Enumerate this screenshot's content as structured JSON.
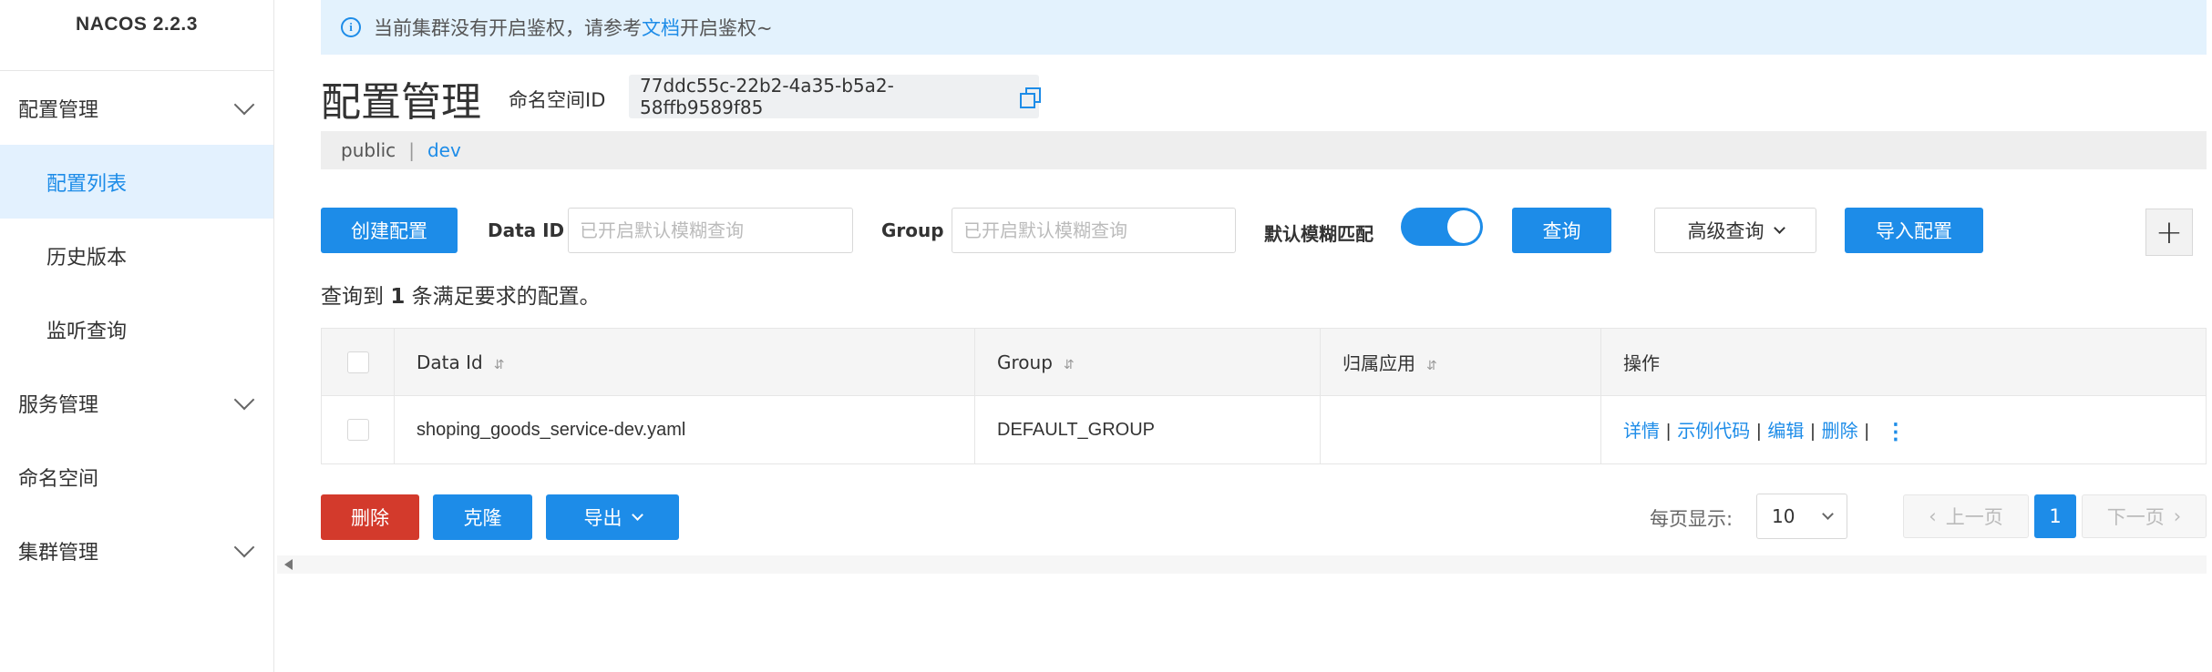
{
  "sidebar": {
    "brand": "NACOS 2.2.3",
    "items": [
      {
        "label": "配置管理",
        "expandable": true
      },
      {
        "label": "配置列表",
        "active": true
      },
      {
        "label": "历史版本"
      },
      {
        "label": "监听查询"
      },
      {
        "label": "服务管理",
        "expandable": true
      },
      {
        "label": "命名空间"
      },
      {
        "label": "集群管理",
        "expandable": true
      }
    ]
  },
  "notice": {
    "prefix": "当前集群没有开启鉴权，请参考",
    "link": "文档",
    "suffix": "开启鉴权~"
  },
  "header": {
    "title": "配置管理",
    "namespace_label": "命名空间ID",
    "namespace_id": "77ddc55c-22b2-4a35-b5a2-58ffb9589f85"
  },
  "namespaces": [
    "public",
    "dev"
  ],
  "namespace_separator": "|",
  "toolbar": {
    "create_label": "创建配置",
    "data_id_label": "Data ID",
    "data_id_placeholder": "已开启默认模糊查询",
    "group_label": "Group",
    "group_placeholder": "已开启默认模糊查询",
    "fuzzy_label": "默认模糊匹配",
    "fuzzy_on": true,
    "query_label": "查询",
    "advanced_label": "高级查询",
    "import_label": "导入配置",
    "plus_label": "+"
  },
  "result": {
    "prefix": "查询到",
    "count": "1",
    "suffix": "条满足要求的配置。"
  },
  "table": {
    "headers": [
      "Data Id",
      "Group",
      "归属应用",
      "操作"
    ],
    "sort_glyph": "⇵",
    "rows": [
      {
        "data_id": "shoping_goods_service-dev.yaml",
        "group": "DEFAULT_GROUP",
        "app": ""
      }
    ],
    "actions": [
      "详情",
      "示例代码",
      "编辑",
      "删除"
    ],
    "action_separator": "|",
    "more_glyph": "⋮"
  },
  "footer": {
    "delete_label": "删除",
    "clone_label": "克隆",
    "export_label": "导出",
    "page_size_label": "每页显示:",
    "page_size": "10",
    "prev_label": "上一页",
    "current_page": "1",
    "next_label": "下一页"
  },
  "colors": {
    "primary": "#1d8ce8",
    "danger": "#d33a2c",
    "notice_bg": "#e3f2fd",
    "active_bg": "#e3f1fe"
  }
}
